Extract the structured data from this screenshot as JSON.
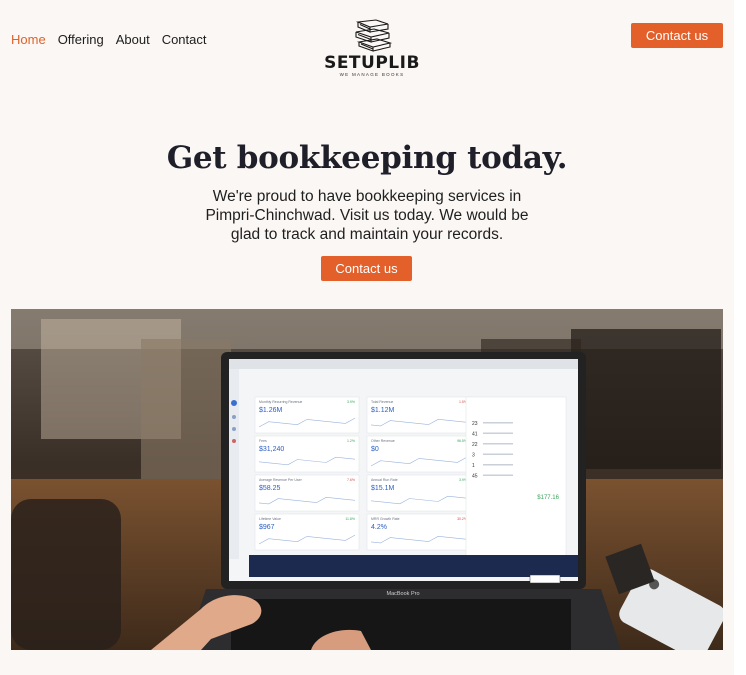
{
  "nav": {
    "items": [
      {
        "label": "Home",
        "active": true
      },
      {
        "label": "Offering",
        "active": false
      },
      {
        "label": "About",
        "active": false
      },
      {
        "label": "Contact",
        "active": false
      }
    ]
  },
  "logo": {
    "name": "SETUPLIB",
    "tagline": "WE MANAGE BOOKS",
    "icon": "stacked-books-icon"
  },
  "header": {
    "cta_label": "Contact us"
  },
  "hero": {
    "title": "Get bookkeeping today.",
    "subtitle": "We're proud to have bookkeeping services in Pimpri-Chinchwad. Visit us today. We would be glad to track and maintain your records.",
    "cta_label": "Contact us"
  },
  "photo": {
    "screen": {
      "cards": [
        {
          "label": "Monthly Recurring Revenue",
          "value": "$1.26M",
          "change": "3.9%"
        },
        {
          "label": "Total Revenue",
          "value": "$1.12M",
          "change": "1.5%"
        },
        {
          "label": "Fees",
          "value": "$31,240",
          "change": "1.2%"
        },
        {
          "label": "Other Revenue",
          "value": "$0",
          "change": "96.5%"
        },
        {
          "label": "Average Revenue Per User",
          "value": "$58.25",
          "change": "7.6%"
        },
        {
          "label": "Annual Run Rate",
          "value": "$15.1M",
          "change": "3.9%"
        },
        {
          "label": "Lifetime Value",
          "value": "$967",
          "change": "11.8%"
        },
        {
          "label": "MRR Growth Rate",
          "value": "4.2%",
          "change": "30.2%"
        }
      ],
      "side_numbers": [
        "23",
        "41",
        "22",
        "3",
        "1",
        "45"
      ],
      "side_highlight": "$177.16",
      "laptop_brand": "MacBook Pro"
    }
  },
  "colors": {
    "accent": "#e3602b",
    "background": "#fbf7f4",
    "text": "#1d1d1d"
  }
}
